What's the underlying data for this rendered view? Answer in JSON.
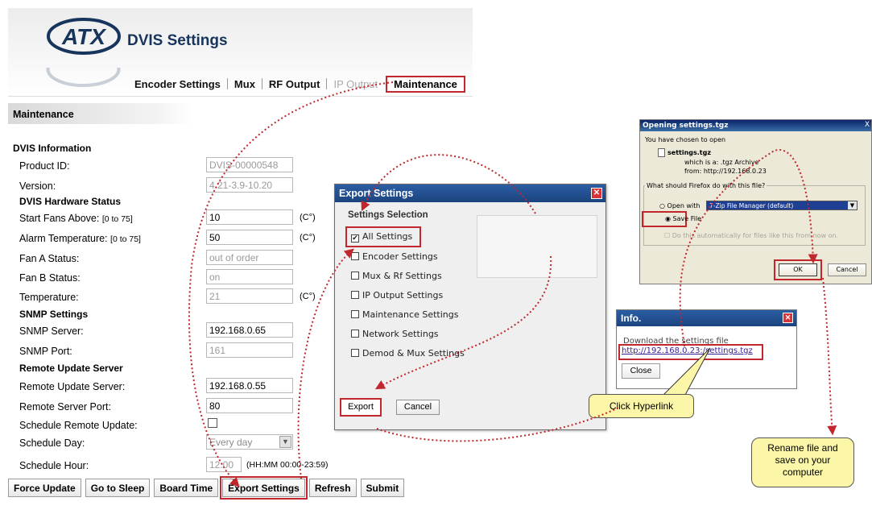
{
  "app": {
    "logo_text": "ATX",
    "title": "DVIS Settings",
    "tabs": [
      {
        "label": "Encoder Settings"
      },
      {
        "label": "Mux"
      },
      {
        "label": "RF Output"
      },
      {
        "label": "IP Output"
      },
      {
        "label": "Maintenance"
      }
    ],
    "section_title": "Maintenance"
  },
  "form": {
    "dvis_info_heading": "DVIS Information",
    "product_id_label": "Product ID:",
    "product_id_value": "DVIS-00000548",
    "version_label": "Version:",
    "version_value": "4.21-3.9-10.20",
    "hw_status_heading": "DVIS Hardware Status",
    "start_fans_label": "Start Fans Above:",
    "start_fans_range": "[0 to 75]",
    "start_fans_value": "10",
    "alarm_temp_label": "Alarm Temperature:",
    "alarm_temp_range": "[0 to 75]",
    "alarm_temp_value": "50",
    "celsius_unit": "(C°)",
    "fan_a_label": "Fan A Status:",
    "fan_a_value": "out of order",
    "fan_b_label": "Fan B Status:",
    "fan_b_value": "on",
    "temperature_label": "Temperature:",
    "temperature_value": "21",
    "snmp_heading": "SNMP Settings",
    "snmp_server_label": "SNMP Server:",
    "snmp_server_value": "192.168.0.65",
    "snmp_port_label": "SNMP Port:",
    "snmp_port_value": "161",
    "remote_heading": "Remote Update Server",
    "remote_server_label": "Remote Update Server:",
    "remote_server_value": "192.168.0.55",
    "remote_port_label": "Remote Server Port:",
    "remote_port_value": "80",
    "schedule_update_label": "Schedule Remote Update:",
    "schedule_day_label": "Schedule Day:",
    "schedule_day_value": "Every day",
    "schedule_hour_label": "Schedule Hour:",
    "schedule_hour_value": "12:00",
    "schedule_hour_hint": "(HH:MM 00:00-23:59)"
  },
  "buttons": {
    "force_update": "Force Update",
    "go_to_sleep": "Go to Sleep",
    "board_time": "Board Time",
    "export_settings": "Export Settings",
    "refresh": "Refresh",
    "submit": "Submit"
  },
  "export_dialog": {
    "title": "Export Settings",
    "close_glyph": "✕",
    "section_heading": "Settings Selection",
    "options": [
      {
        "label": "All Settings",
        "checked": true
      },
      {
        "label": "Encoder Settings",
        "checked": false
      },
      {
        "label": "Mux & Rf Settings",
        "checked": false
      },
      {
        "label": "IP Output Settings",
        "checked": false
      },
      {
        "label": "Maintenance Settings",
        "checked": false
      },
      {
        "label": "Network Settings",
        "checked": false
      },
      {
        "label": "Demod & Mux Settings",
        "checked": false
      }
    ],
    "check_glyph": "✔",
    "export_label": "Export",
    "cancel_label": "Cancel"
  },
  "firefox_dialog": {
    "title": "Opening settings.tgz",
    "close_glyph": "X",
    "chosen_text": "You have chosen to open",
    "filename": "settings.tgz",
    "which_is": "which is a: .tgz Archive",
    "from": "from: http://192.168.0.23",
    "question": "What should Firefox do with this file?",
    "open_with_label": "Open with",
    "open_with_app": "7-Zip File Manager (default)",
    "save_file_label": "Save File",
    "auto_label": "Do this automatically for files like this from now on.",
    "ok_label": "OK",
    "cancel_label": "Cancel"
  },
  "info_dialog": {
    "title": "Info.",
    "close_glyph": "✕",
    "text": "Download the settings file",
    "link": "http://192.168.0.23:/settings.tgz",
    "close_label": "Close"
  },
  "callouts": {
    "hyperlink": "Click Hyperlink",
    "rename": "Rename file and\nsave on your\ncomputer"
  },
  "colors": {
    "highlight_red": "#c1272d",
    "title_navy": "#17345d",
    "dialog_blue": "#2b5ea4",
    "callout_yellow": "#fbf6a8"
  }
}
